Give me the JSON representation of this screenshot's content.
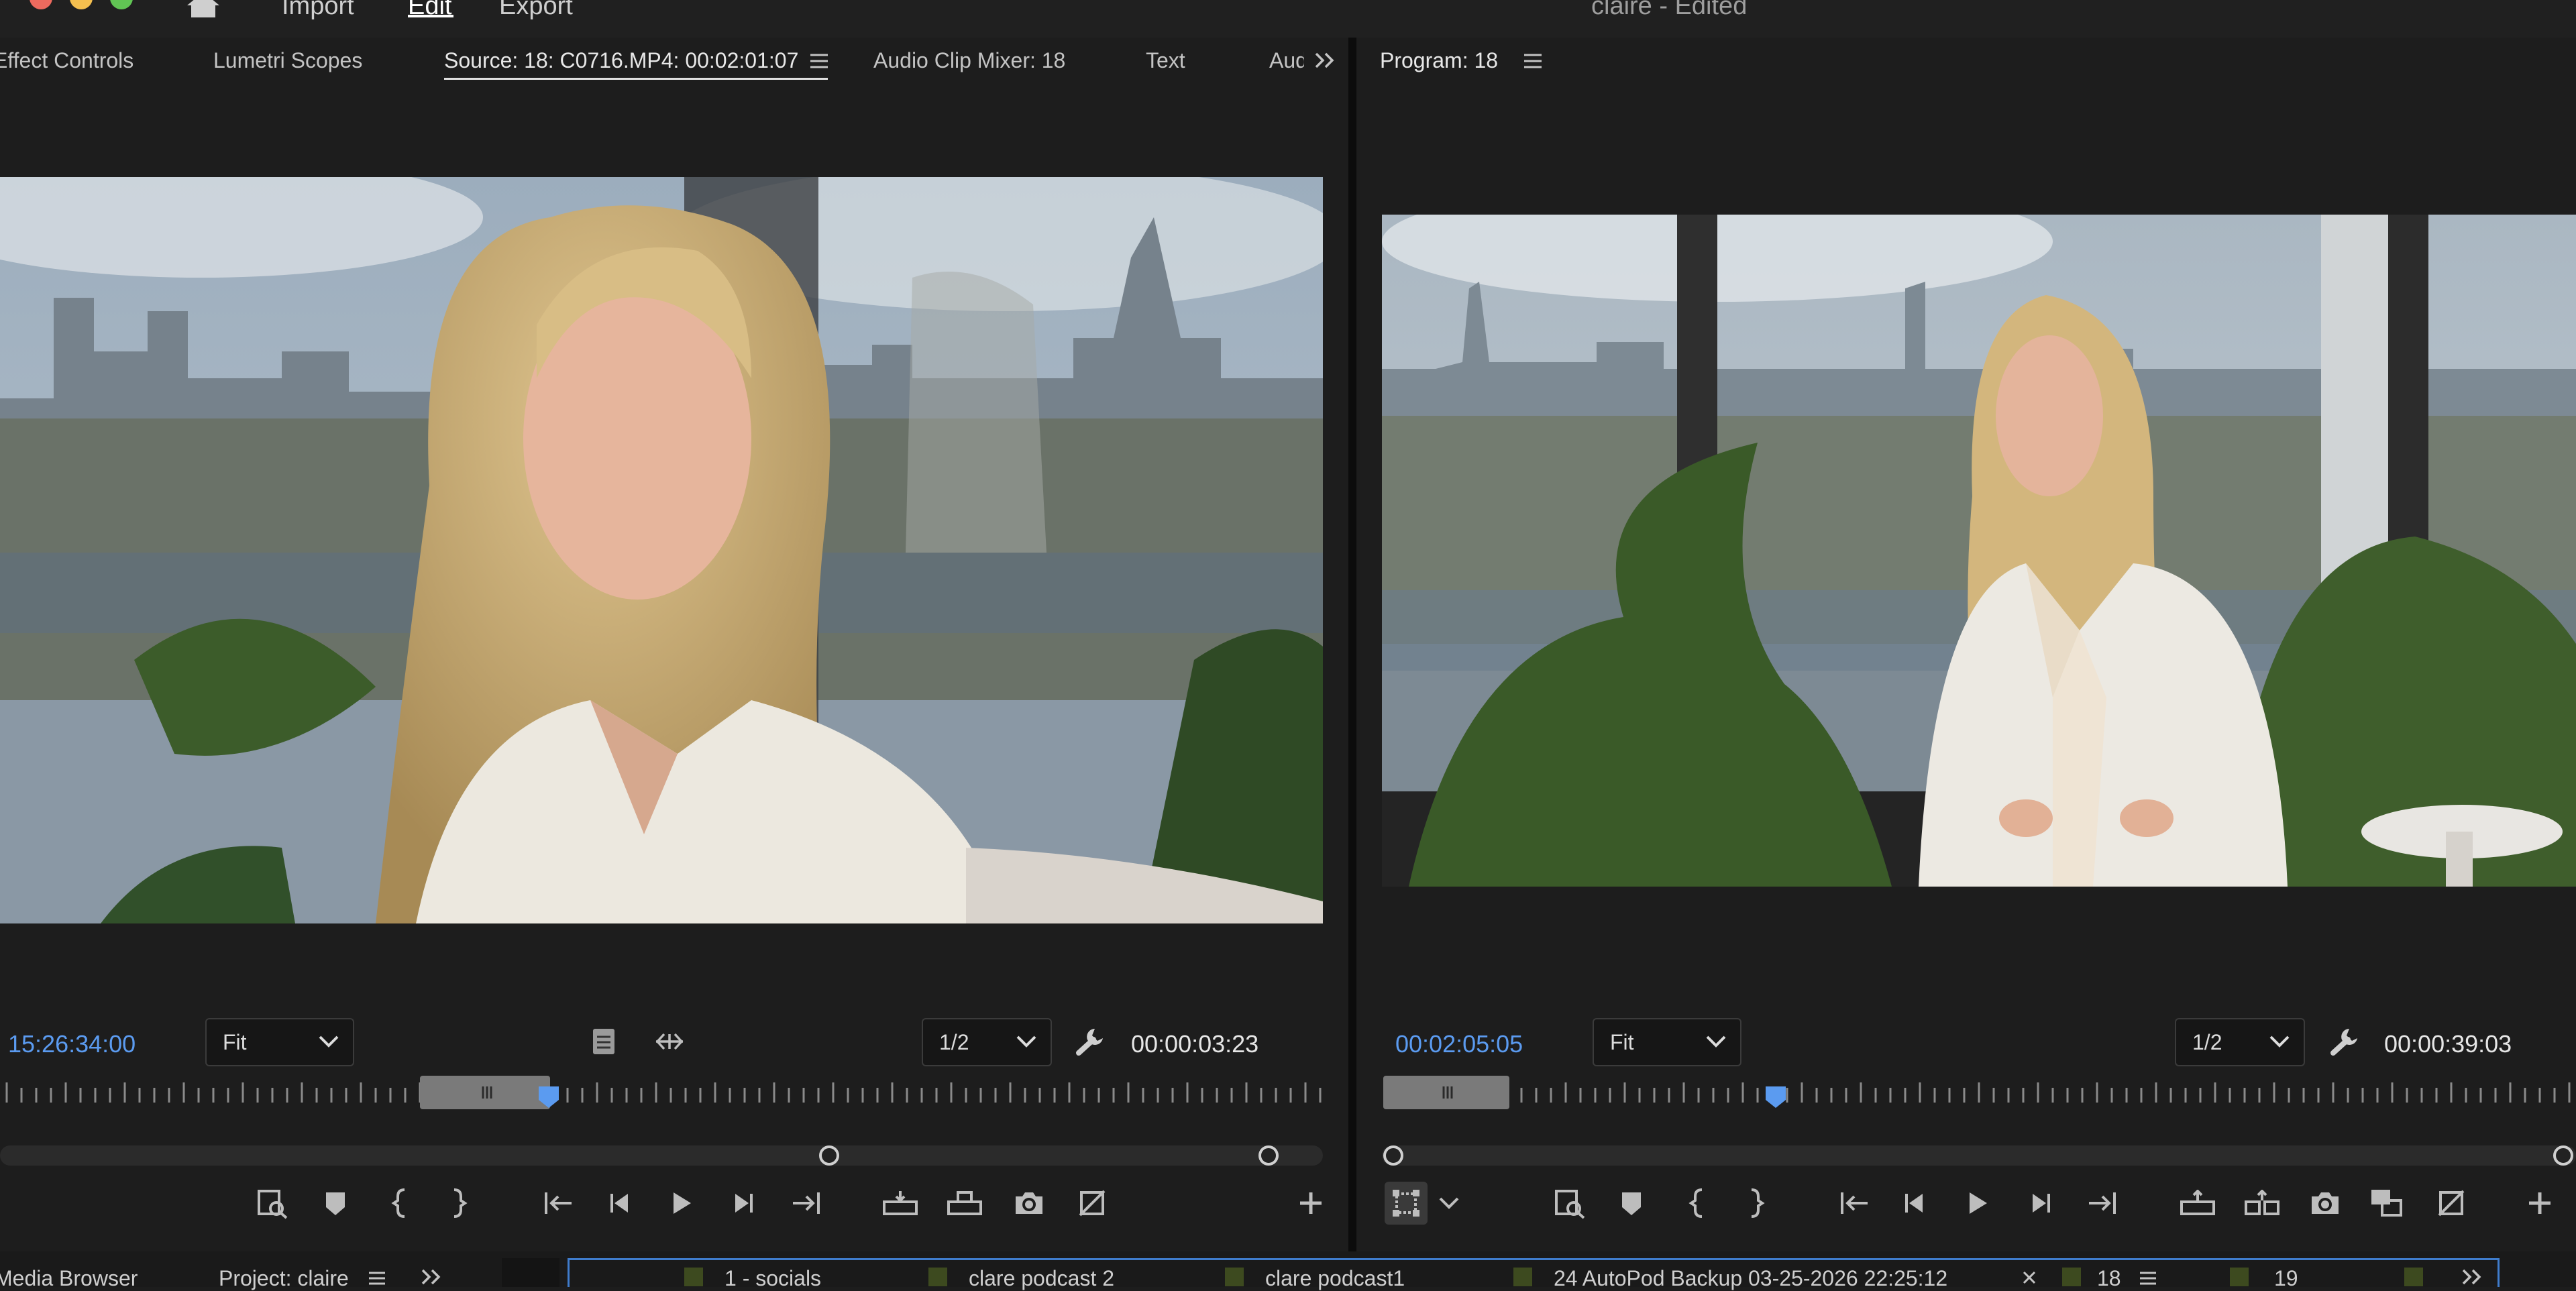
{
  "app": {
    "window_title": "claire - Edited",
    "menu": [
      "Import",
      "Edit",
      "Export"
    ],
    "active_menu": "Edit"
  },
  "source_panel": {
    "tabs": [
      "Effect Controls",
      "Lumetri Scopes",
      "Source: 18: C0716.MP4: 00:02:01:07",
      "Audio Clip Mixer: 18",
      "Text",
      "Aud"
    ],
    "active_tab": "Source: 18: C0716.MP4: 00:02:01:07",
    "timecode": "15:26:34:00",
    "zoom": "Fit",
    "resolution": "1/2",
    "duration": "00:00:03:23",
    "playhead_fraction": 0.415
  },
  "program_panel": {
    "tab": "Program: 18",
    "timecode": "00:02:05:05",
    "zoom": "Fit",
    "resolution": "1/2",
    "duration": "00:00:39:03",
    "playhead_fraction": 0.33
  },
  "bottom": {
    "left_tabs": [
      "Media Browser",
      "Project: claire"
    ],
    "sequence_tabs": [
      "1 - socials",
      "clare podcast 2",
      "clare podcast1",
      "24 AutoPod Backup 03-25-2026 22:25:12",
      "18",
      "19"
    ]
  },
  "colors": {
    "accent_blue": "#5b9bf0",
    "panel_bg": "#1d1d1d",
    "sequence_chip": "#3d4a1f"
  }
}
